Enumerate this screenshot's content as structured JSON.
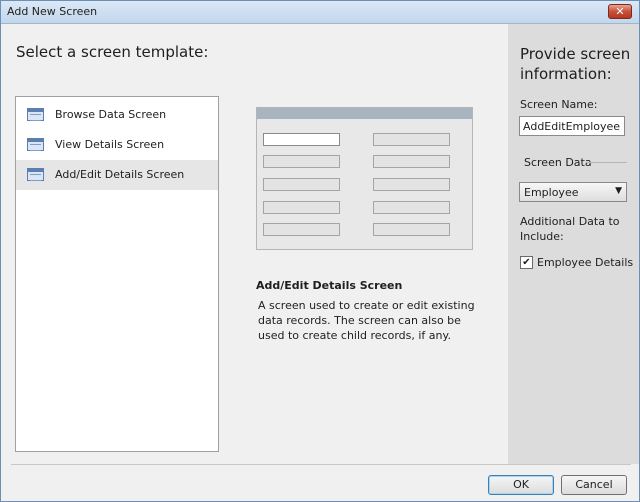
{
  "window": {
    "title": "Add New Screen",
    "close_glyph": "✕"
  },
  "left": {
    "heading": "Select a screen template:",
    "templates": [
      {
        "label": "Browse Data Screen"
      },
      {
        "label": "View Details Screen"
      },
      {
        "label": "Add/Edit Details Screen"
      }
    ],
    "selected_index": 2
  },
  "description": {
    "title": "Add/Edit Details Screen",
    "text": "A screen used to create or edit existing data records. The screen can also be used to create child records, if any."
  },
  "right": {
    "heading": "Provide screen information:",
    "screen_name_label": "Screen Name:",
    "screen_name_value": "AddEditEmployee",
    "screen_data_label": "Screen Data",
    "screen_data_value": "Employee",
    "additional_label": "Additional Data to Include:",
    "checkbox_label": "Employee Details",
    "checkbox_checked": true,
    "check_glyph": "✔"
  },
  "buttons": {
    "ok": "OK",
    "cancel": "Cancel"
  },
  "icons": {
    "template_icon": "screen-layout-icon",
    "dropdown_icon": "chevron-down-icon",
    "close_icon": "close-icon"
  },
  "colors": {
    "selected_row": "#e6e6e6",
    "right_panel": "#dcdcdc",
    "title_bar": "#c3d6ec"
  }
}
